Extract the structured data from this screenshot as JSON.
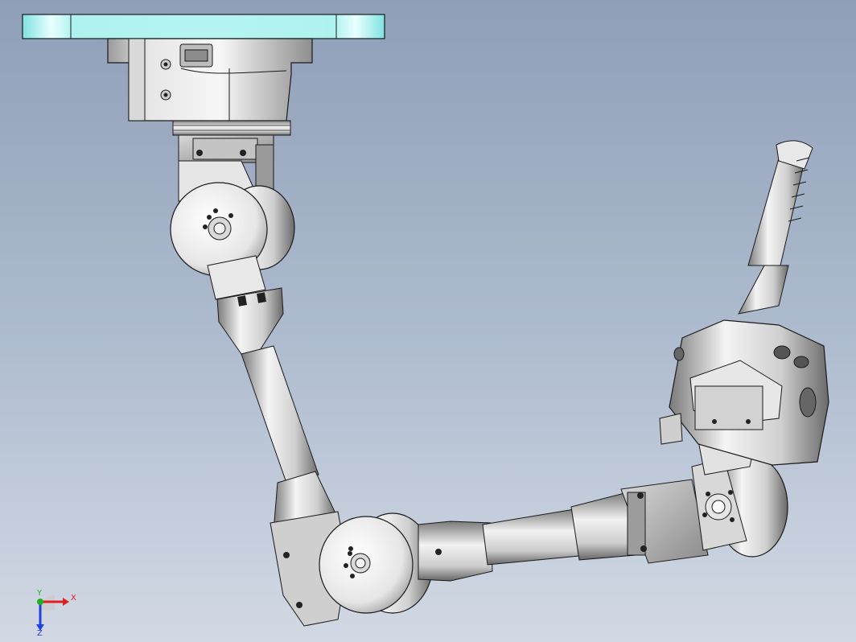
{
  "viewport": {
    "background_top": "#8f9fb8",
    "background_bottom": "#d2d9e4"
  },
  "model": {
    "description_icon": "robot-arm-assembly",
    "colors": {
      "metal_light": "#f0f0f0",
      "metal_mid": "#c9c9c9",
      "metal_dark": "#6e6e6e",
      "edge": "#1a1a1a",
      "mount_plate": "#9ef0ef"
    }
  },
  "triad": {
    "x_label": "X",
    "y_label": "Y",
    "z_label": "Z",
    "x_color": "#e02020",
    "y_color": "#20b020",
    "z_color": "#2040e0"
  }
}
